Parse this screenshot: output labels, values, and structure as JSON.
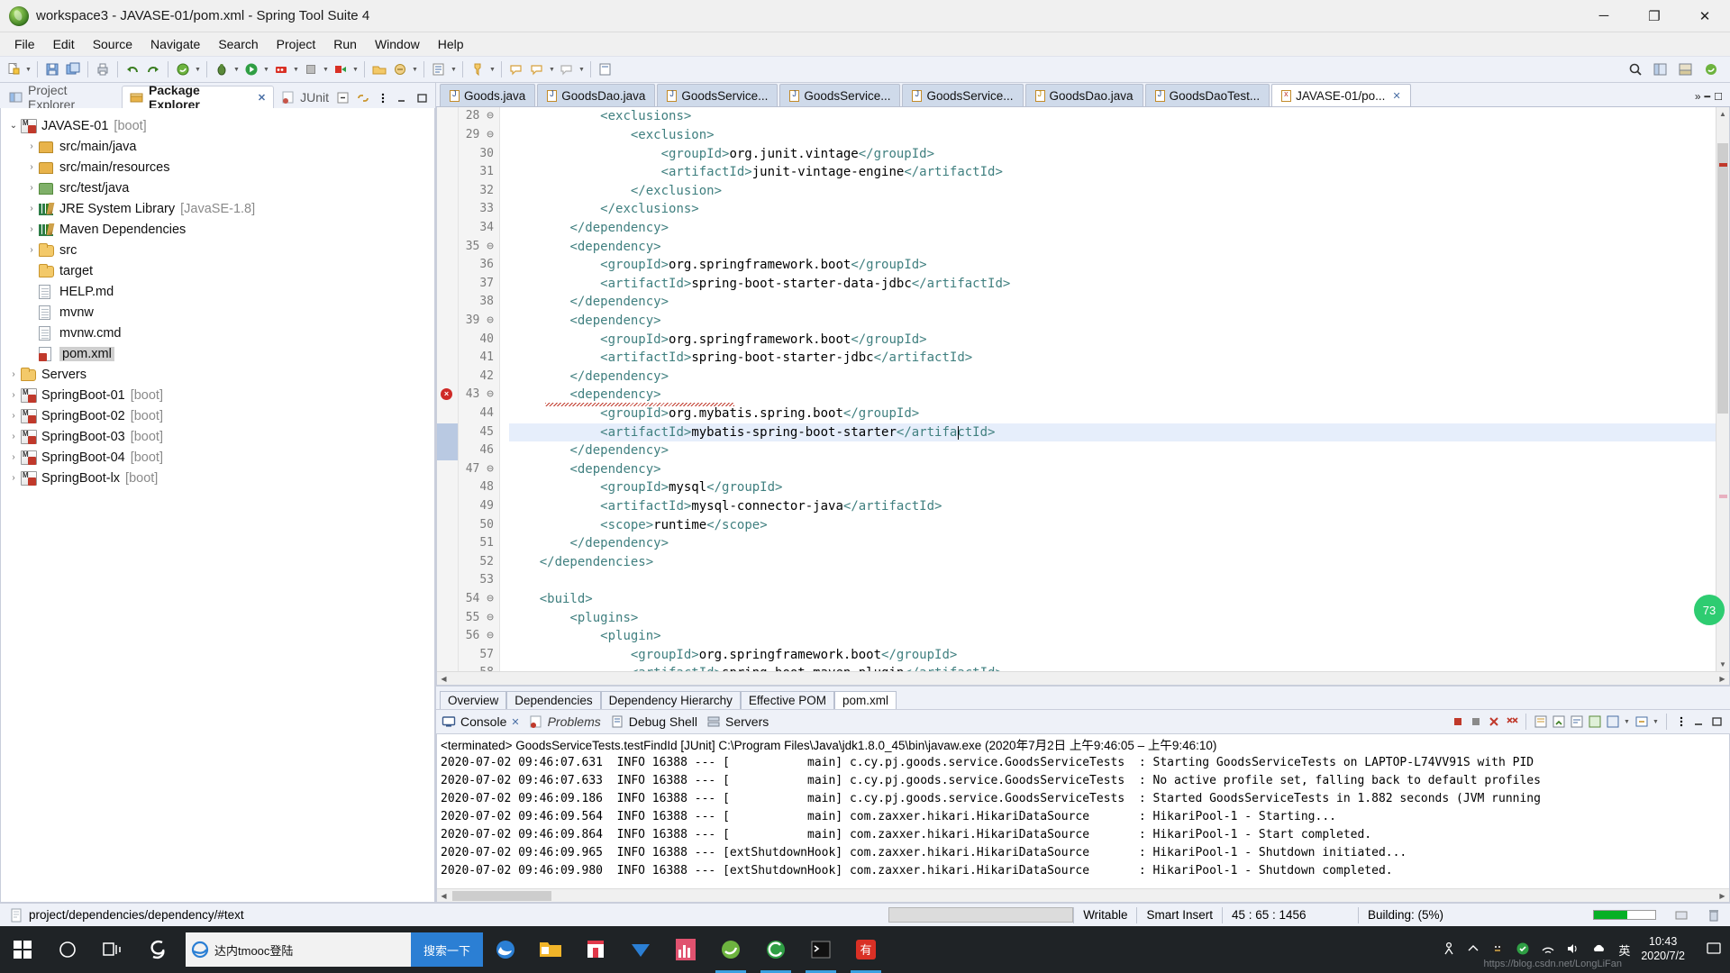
{
  "window": {
    "title": "workspace3 - JAVASE-01/pom.xml - Spring Tool Suite 4",
    "app_icon": "sts-leaf-icon",
    "minimize": "─",
    "maximize": "❐",
    "close": "✕"
  },
  "menu": [
    "File",
    "Edit",
    "Source",
    "Navigate",
    "Search",
    "Project",
    "Run",
    "Window",
    "Help"
  ],
  "left_view": {
    "tabs": [
      {
        "label": "Project Explorer",
        "icon": "project-explorer-icon",
        "active": false,
        "closable": false
      },
      {
        "label": "Package Explorer",
        "icon": "package-explorer-icon",
        "active": true,
        "closable": true
      },
      {
        "label": "JUnit",
        "icon": "junit-icon",
        "active": false,
        "closable": false
      }
    ],
    "tree": [
      {
        "label": "JAVASE-01",
        "suffix": "[boot]",
        "icon": "maven-project-icon",
        "arrow": "open",
        "indent": 0,
        "selected": false
      },
      {
        "label": "src/main/java",
        "suffix": "",
        "icon": "source-folder-icon",
        "arrow": "closed",
        "indent": 1,
        "selected": false
      },
      {
        "label": "src/main/resources",
        "suffix": "",
        "icon": "source-folder-icon",
        "arrow": "closed",
        "indent": 1,
        "selected": false
      },
      {
        "label": "src/test/java",
        "suffix": "",
        "icon": "test-source-folder-icon",
        "arrow": "closed",
        "indent": 1,
        "selected": false
      },
      {
        "label": "JRE System Library",
        "suffix": "[JavaSE-1.8]",
        "icon": "library-icon",
        "arrow": "closed",
        "indent": 1,
        "selected": false
      },
      {
        "label": "Maven Dependencies",
        "suffix": "",
        "icon": "library-icon",
        "arrow": "closed",
        "indent": 1,
        "selected": false
      },
      {
        "label": "src",
        "suffix": "",
        "icon": "folder-icon",
        "arrow": "closed",
        "indent": 1,
        "selected": false
      },
      {
        "label": "target",
        "suffix": "",
        "icon": "folder-icon",
        "arrow": "none",
        "indent": 1,
        "selected": false
      },
      {
        "label": "HELP.md",
        "suffix": "",
        "icon": "file-icon",
        "arrow": "none",
        "indent": 1,
        "selected": false
      },
      {
        "label": "mvnw",
        "suffix": "",
        "icon": "file-icon",
        "arrow": "none",
        "indent": 1,
        "selected": false
      },
      {
        "label": "mvnw.cmd",
        "suffix": "",
        "icon": "file-icon",
        "arrow": "none",
        "indent": 1,
        "selected": false
      },
      {
        "label": "pom.xml",
        "suffix": "",
        "icon": "xml-file-icon",
        "arrow": "none",
        "indent": 1,
        "selected": true
      },
      {
        "label": "Servers",
        "suffix": "",
        "icon": "folder-icon",
        "arrow": "closed",
        "indent": 0,
        "selected": false
      },
      {
        "label": "SpringBoot-01",
        "suffix": "[boot]",
        "icon": "maven-project-icon",
        "arrow": "closed",
        "indent": 0,
        "selected": false
      },
      {
        "label": "SpringBoot-02",
        "suffix": "[boot]",
        "icon": "maven-project-icon",
        "arrow": "closed",
        "indent": 0,
        "selected": false
      },
      {
        "label": "SpringBoot-03",
        "suffix": "[boot]",
        "icon": "maven-project-icon",
        "arrow": "closed",
        "indent": 0,
        "selected": false
      },
      {
        "label": "SpringBoot-04",
        "suffix": "[boot]",
        "icon": "maven-project-icon",
        "arrow": "closed",
        "indent": 0,
        "selected": false
      },
      {
        "label": "SpringBoot-lx",
        "suffix": "[boot]",
        "icon": "maven-project-icon",
        "arrow": "closed",
        "indent": 0,
        "selected": false
      }
    ]
  },
  "editor": {
    "tabs": [
      {
        "label": "Goods.java",
        "icon": "java-file-icon",
        "active": false
      },
      {
        "label": "GoodsDao.java",
        "icon": "java-file-icon",
        "active": false
      },
      {
        "label": "GoodsService...",
        "icon": "java-file-icon",
        "active": false
      },
      {
        "label": "GoodsService...",
        "icon": "java-file-icon",
        "active": false
      },
      {
        "label": "GoodsService...",
        "icon": "java-file-icon",
        "active": false
      },
      {
        "label": "GoodsDao.java",
        "icon": "java-file-warning-icon",
        "active": false
      },
      {
        "label": "GoodsDaoTest...",
        "icon": "java-file-icon",
        "active": false
      },
      {
        "label": "JAVASE-01/po...",
        "icon": "xml-file-icon",
        "active": true
      }
    ],
    "more_tabs": "»",
    "first_line_number": 28,
    "lines": [
      {
        "n": 28,
        "fold": "⊖",
        "text": "            <exclusions>",
        "error": false,
        "highlight": false,
        "clipped_top": true
      },
      {
        "n": 29,
        "fold": "⊖",
        "text": "                <exclusion>",
        "error": false,
        "highlight": false
      },
      {
        "n": 30,
        "fold": "",
        "text": "                    <groupId>org.junit.vintage</groupId>",
        "error": false,
        "highlight": false
      },
      {
        "n": 31,
        "fold": "",
        "text": "                    <artifactId>junit-vintage-engine</artifactId>",
        "error": false,
        "highlight": false
      },
      {
        "n": 32,
        "fold": "",
        "text": "                </exclusion>",
        "error": false,
        "highlight": false
      },
      {
        "n": 33,
        "fold": "",
        "text": "            </exclusions>",
        "error": false,
        "highlight": false
      },
      {
        "n": 34,
        "fold": "",
        "text": "        </dependency>",
        "error": false,
        "highlight": false
      },
      {
        "n": 35,
        "fold": "⊖",
        "text": "        <dependency>",
        "error": false,
        "highlight": false
      },
      {
        "n": 36,
        "fold": "",
        "text": "            <groupId>org.springframework.boot</groupId>",
        "error": false,
        "highlight": false
      },
      {
        "n": 37,
        "fold": "",
        "text": "            <artifactId>spring-boot-starter-data-jdbc</artifactId>",
        "error": false,
        "highlight": false
      },
      {
        "n": 38,
        "fold": "",
        "text": "        </dependency>",
        "error": false,
        "highlight": false
      },
      {
        "n": 39,
        "fold": "⊖",
        "text": "        <dependency>",
        "error": false,
        "highlight": false
      },
      {
        "n": 40,
        "fold": "",
        "text": "            <groupId>org.springframework.boot</groupId>",
        "error": false,
        "highlight": false
      },
      {
        "n": 41,
        "fold": "",
        "text": "            <artifactId>spring-boot-starter-jdbc</artifactId>",
        "error": false,
        "highlight": false
      },
      {
        "n": 42,
        "fold": "",
        "text": "        </dependency>",
        "error": false,
        "highlight": false
      },
      {
        "n": 43,
        "fold": "⊖",
        "text": "        <dependency>",
        "error": true,
        "highlight": false
      },
      {
        "n": 44,
        "fold": "",
        "text": "            <groupId>org.mybatis.spring.boot</groupId>",
        "error": false,
        "highlight": false
      },
      {
        "n": 45,
        "fold": "",
        "text": "            <artifactId>mybatis-spring-boot-starter</artifactId>",
        "error": false,
        "highlight": true,
        "caret": true
      },
      {
        "n": 46,
        "fold": "",
        "text": "        </dependency>",
        "error": false,
        "highlight": false
      },
      {
        "n": 47,
        "fold": "⊖",
        "text": "        <dependency>",
        "error": false,
        "highlight": false
      },
      {
        "n": 48,
        "fold": "",
        "text": "            <groupId>mysql</groupId>",
        "error": false,
        "highlight": false
      },
      {
        "n": 49,
        "fold": "",
        "text": "            <artifactId>mysql-connector-java</artifactId>",
        "error": false,
        "highlight": false
      },
      {
        "n": 50,
        "fold": "",
        "text": "            <scope>runtime</scope>",
        "error": false,
        "highlight": false
      },
      {
        "n": 51,
        "fold": "",
        "text": "        </dependency>",
        "error": false,
        "highlight": false
      },
      {
        "n": 52,
        "fold": "",
        "text": "    </dependencies>",
        "error": false,
        "highlight": false
      },
      {
        "n": 53,
        "fold": "",
        "text": "",
        "error": false,
        "highlight": false
      },
      {
        "n": 54,
        "fold": "⊖",
        "text": "    <build>",
        "error": false,
        "highlight": false
      },
      {
        "n": 55,
        "fold": "⊖",
        "text": "        <plugins>",
        "error": false,
        "highlight": false
      },
      {
        "n": 56,
        "fold": "⊖",
        "text": "            <plugin>",
        "error": false,
        "highlight": false
      },
      {
        "n": 57,
        "fold": "",
        "text": "                <groupId>org.springframework.boot</groupId>",
        "error": false,
        "highlight": false
      },
      {
        "n": 58,
        "fold": "",
        "text": "                <artifactId>spring-boot-maven-plugin</artifactId>",
        "error": false,
        "highlight": false
      }
    ],
    "form_tabs": [
      {
        "label": "Overview",
        "active": false
      },
      {
        "label": "Dependencies",
        "active": false
      },
      {
        "label": "Dependency Hierarchy",
        "active": false
      },
      {
        "label": "Effective POM",
        "active": false
      },
      {
        "label": "pom.xml",
        "active": true
      }
    ]
  },
  "console": {
    "tabs": [
      {
        "label": "Console",
        "icon": "console-icon",
        "active": true,
        "closable": true
      },
      {
        "label": "Problems",
        "icon": "problems-icon",
        "active": false,
        "closable": false
      },
      {
        "label": "Debug Shell",
        "icon": "debug-shell-icon",
        "active": false,
        "closable": false
      },
      {
        "label": "Servers",
        "icon": "servers-icon",
        "active": false,
        "closable": false
      }
    ],
    "header": "<terminated> GoodsServiceTests.testFindId [JUnit] C:\\Program Files\\Java\\jdk1.8.0_45\\bin\\javaw.exe  (2020年7月2日 上午9:46:05 – 上午9:46:10)",
    "lines": [
      "2020-07-02 09:46:07.631  INFO 16388 --- [           main] c.cy.pj.goods.service.GoodsServiceTests  : Starting GoodsServiceTests on LAPTOP-L74VV91S with PID",
      "2020-07-02 09:46:07.633  INFO 16388 --- [           main] c.cy.pj.goods.service.GoodsServiceTests  : No active profile set, falling back to default profiles",
      "2020-07-02 09:46:09.186  INFO 16388 --- [           main] c.cy.pj.goods.service.GoodsServiceTests  : Started GoodsServiceTests in 1.882 seconds (JVM running",
      "2020-07-02 09:46:09.564  INFO 16388 --- [           main] com.zaxxer.hikari.HikariDataSource       : HikariPool-1 - Starting...",
      "2020-07-02 09:46:09.864  INFO 16388 --- [           main] com.zaxxer.hikari.HikariDataSource       : HikariPool-1 - Start completed.",
      "2020-07-02 09:46:09.965  INFO 16388 --- [extShutdownHook] com.zaxxer.hikari.HikariDataSource       : HikariPool-1 - Shutdown initiated...",
      "2020-07-02 09:46:09.980  INFO 16388 --- [extShutdownHook] com.zaxxer.hikari.HikariDataSource       : HikariPool-1 - Shutdown completed."
    ]
  },
  "statusbar": {
    "path": "project/dependencies/dependency/#text",
    "path_icon": "document-icon",
    "input_value": "",
    "writable": "Writable",
    "insert_mode": "Smart Insert",
    "position": "45 : 65 : 1456",
    "build_status": "Building: (5%)",
    "progress_percent": 55,
    "progress_color": "#06b025"
  },
  "taskbar": {
    "start_icon": "windows-start-icon",
    "cortana_icon": "cortana-circle-icon",
    "taskview_icon": "task-view-icon",
    "search_placeholder": "达内tmooc登陆",
    "search_button": "搜索一下",
    "apps": [
      {
        "name": "sogou-icon"
      },
      {
        "name": "ie-icon"
      },
      {
        "name": "edge-icon"
      },
      {
        "name": "file-explorer-icon"
      },
      {
        "name": "microsoft-store-icon"
      },
      {
        "name": "onedrive-icon"
      },
      {
        "name": "charts-app-icon"
      },
      {
        "name": "sts-icon"
      },
      {
        "name": "360-browser-icon"
      },
      {
        "name": "terminal-icon"
      },
      {
        "name": "youdao-icon"
      }
    ],
    "tray": [
      "person-icon",
      "chevron-up-icon",
      "qq-icon",
      "shield-icon",
      "network-icon",
      "volume-icon",
      "cloud-icon",
      "ime-en-icon",
      "ime-cn-icon"
    ],
    "clock_time": "10:43",
    "clock_date": "2020/7/2",
    "watermark": "https://blog.csdn.net/LongLiFan"
  },
  "badge": {
    "value": "73"
  },
  "colors": {
    "accent": "#2b7fd4",
    "tag": "#3f7f7f",
    "error": "#c0392b",
    "highlight": "#e6eefb",
    "chrome": "#eef1f8"
  }
}
